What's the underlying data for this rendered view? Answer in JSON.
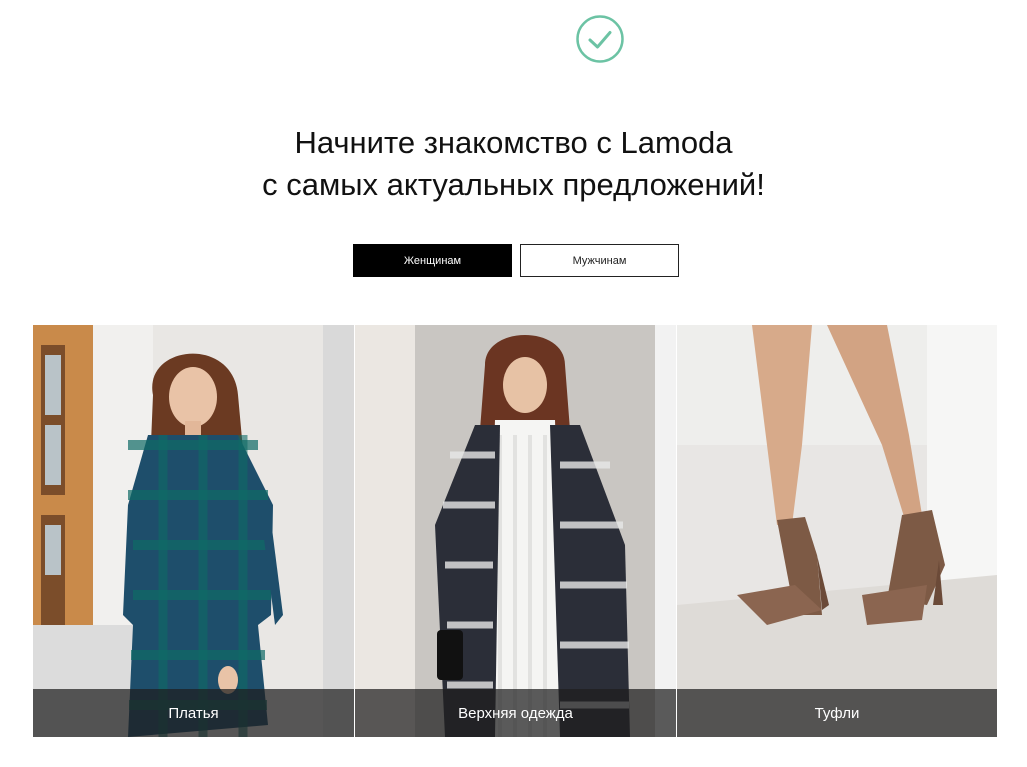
{
  "header": {
    "success_icon": "check-circle-icon",
    "accent_color": "#6cc3a4"
  },
  "headline": {
    "line1": "Начните знакомство с Lamoda",
    "line2": "с самых актуальных предложений!"
  },
  "gender_tabs": [
    {
      "label": "Женщинам",
      "active": true
    },
    {
      "label": "Мужчинам",
      "active": false
    }
  ],
  "categories": [
    {
      "label": "Платья",
      "image": "woman-in-plaid-dress-photo"
    },
    {
      "label": "Верхняя одежда",
      "image": "woman-in-checked-coat-photo"
    },
    {
      "label": "Туфли",
      "image": "suede-ankle-strap-heels-photo"
    }
  ]
}
